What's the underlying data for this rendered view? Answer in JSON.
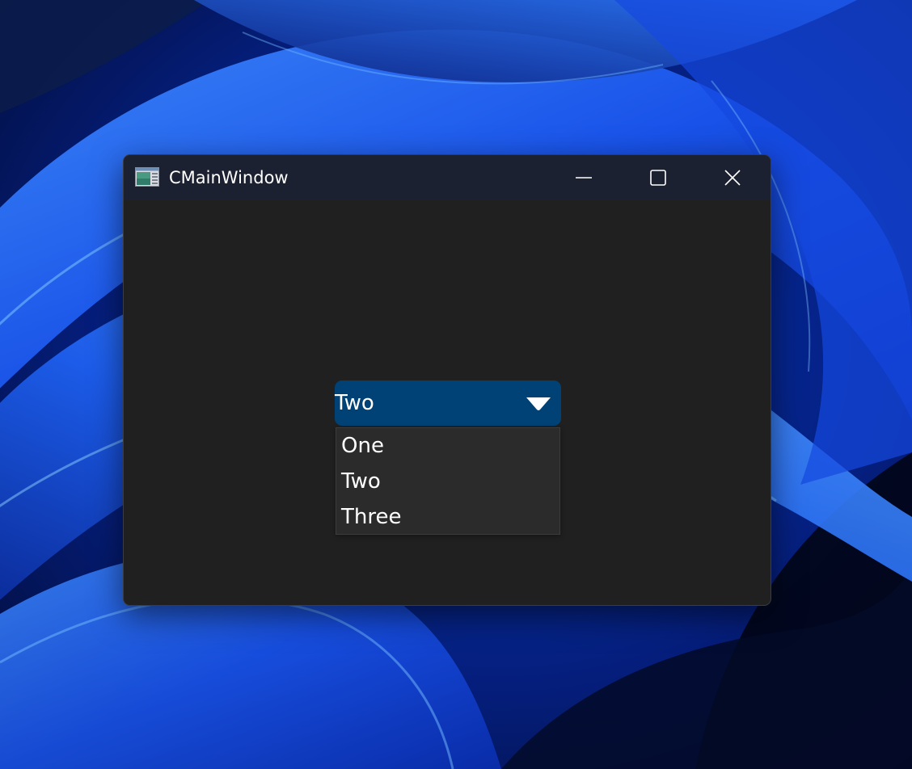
{
  "window": {
    "title": "CMainWindow",
    "buttons": {
      "minimize": "minimize-icon",
      "maximize": "maximize-icon",
      "close": "close-icon"
    }
  },
  "combo": {
    "selected": "Two",
    "options": [
      "One",
      "Two",
      "Three"
    ],
    "expanded": true
  },
  "colors": {
    "titlebar": "#1c2131",
    "client": "#202020",
    "combo_bg": "#004275",
    "list_bg": "#2b2b2b",
    "text": "#ffffff"
  }
}
